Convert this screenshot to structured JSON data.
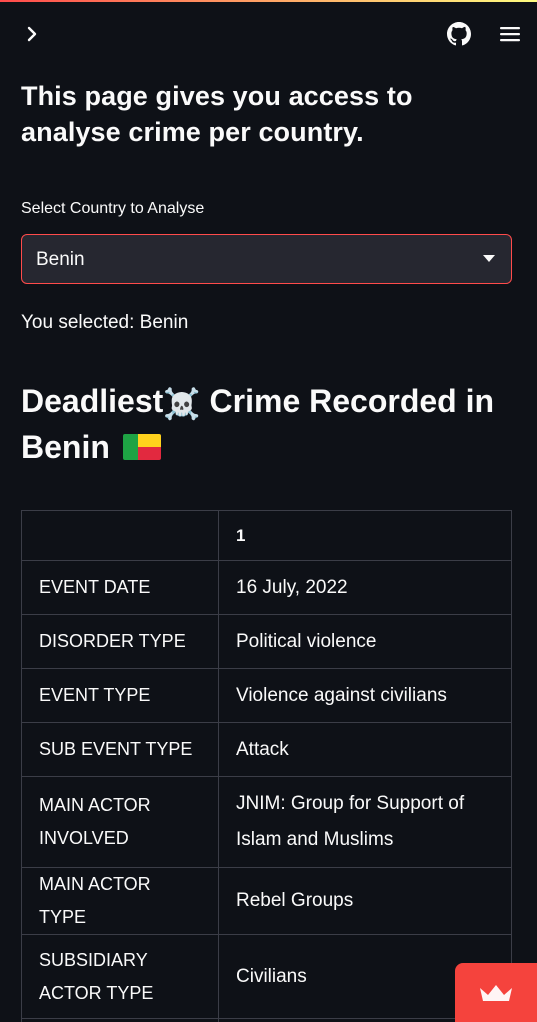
{
  "header": {
    "expand_icon": "chevron-right-icon",
    "github_icon": "github-icon",
    "menu_icon": "hamburger-menu-icon"
  },
  "intro": {
    "title": "This page gives you access to analyse crime per country."
  },
  "country_select": {
    "label": "Select Country to Analyse",
    "value": "Benin"
  },
  "selected_text": "You selected: Benin",
  "deadliest": {
    "title_part1": "Deadliest",
    "title_part2": " Crime Recorded in Benin ",
    "skull": "☠️",
    "flag_icon": "benin-flag-icon"
  },
  "table": {
    "index_header": "",
    "column_header": "1",
    "rows": [
      {
        "key": "EVENT DATE",
        "value": "16 July, 2022"
      },
      {
        "key": "DISORDER TYPE",
        "value": "Political violence"
      },
      {
        "key": "EVENT TYPE",
        "value": "Violence against civilians"
      },
      {
        "key": "SUB EVENT TYPE",
        "value": "Attack"
      },
      {
        "key": "MAIN ACTOR INVOLVED",
        "value": "JNIM: Group for Support of Islam and Muslims"
      },
      {
        "key": "MAIN ACTOR TYPE",
        "value": "Rebel Groups"
      },
      {
        "key": "SUBSIDIARY ACTOR TYPE",
        "value": "Civilians"
      },
      {
        "key": "",
        "value": ""
      }
    ]
  },
  "badge": {
    "icon": "streamlit-crown-icon"
  },
  "colors": {
    "background": "#0e1117",
    "select_background": "#262730",
    "accent": "#ff4b4b",
    "badge": "#f5433d",
    "table_border": "#3b3d47"
  }
}
